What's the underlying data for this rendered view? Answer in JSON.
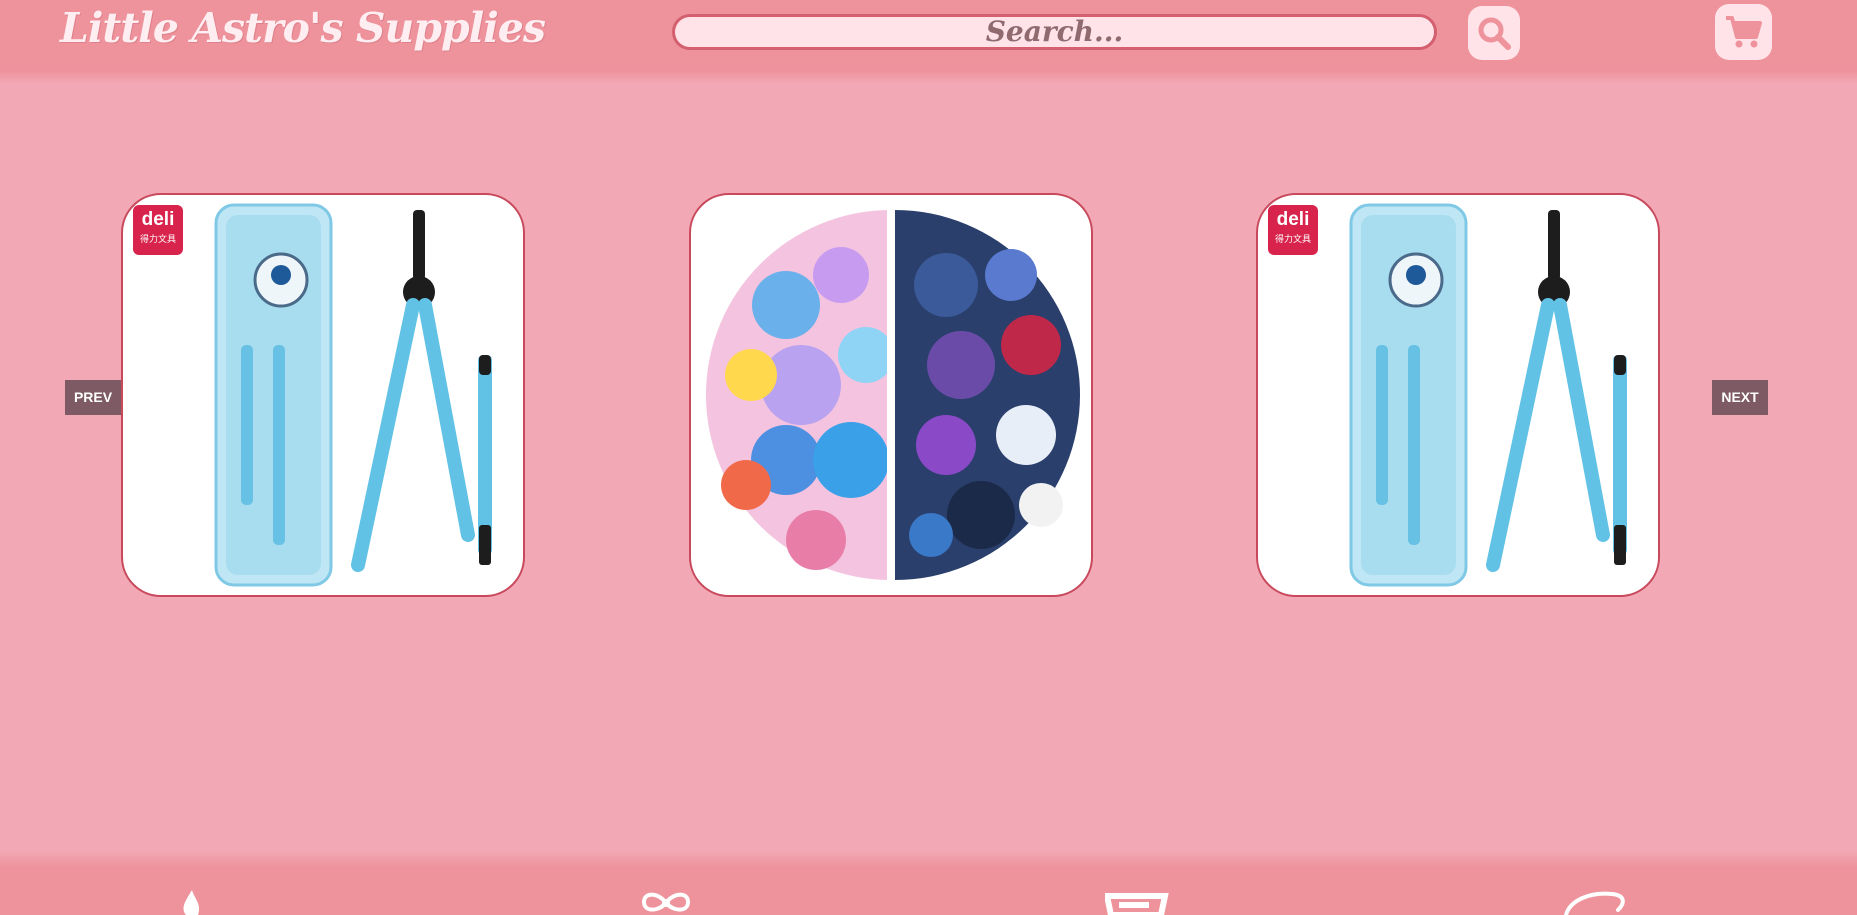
{
  "header": {
    "logo": "Little Astro's Supplies",
    "search_placeholder": "Search...",
    "search_icon": "search-icon",
    "cart_icon": "cart-icon"
  },
  "carousel": {
    "prev_label": "PREV",
    "next_label": "NEXT",
    "slides": [
      {
        "name": "compass-set",
        "brand_badge": "deli",
        "brand_sub": "得力文具"
      },
      {
        "name": "space-stickers"
      },
      {
        "name": "compass-set",
        "brand_badge": "deli",
        "brand_sub": "得力文具"
      }
    ]
  },
  "footer": {
    "icons": [
      "flame-icon",
      "bow-icon",
      "stationery-icon",
      "planet-icon"
    ]
  },
  "colors": {
    "header_bg": "#ee929b",
    "page_bg": "#f2a9b5",
    "accent": "#d4606f",
    "nav_button": "#7e5b64"
  }
}
